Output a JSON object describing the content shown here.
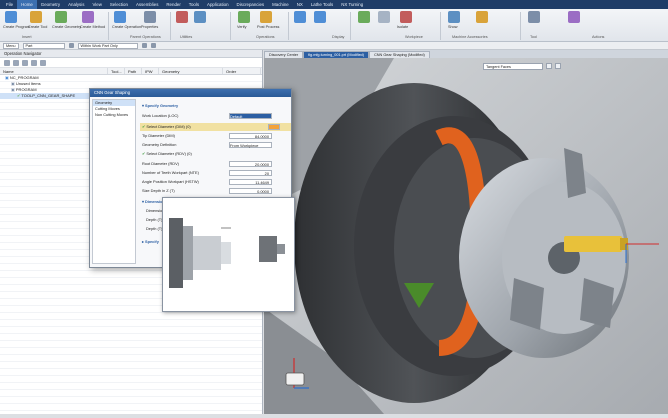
{
  "menu": [
    "File",
    "Home",
    "Geometry",
    "Analysis",
    "View",
    "Selection",
    "Assemblies",
    "Render",
    "Tools",
    "Application",
    "Discrepancies",
    "Machine",
    "NX",
    "Lathe Tools",
    "NX Turning"
  ],
  "menu_active_index": 1,
  "ribbon": {
    "buttons": [
      "Create Program",
      "Create Tool",
      "Create Geometry",
      "Create Method",
      "Create Operation",
      "Properties",
      "Shop Documentation",
      "Mfg Objects",
      "Verify",
      "Post Process",
      "Generate Tool Path",
      "Display Tool Path",
      "Simulate",
      "Cut Stock",
      "Isolate",
      "Show",
      "Display Object",
      "Sync",
      "Scroll"
    ],
    "groups": [
      "Insert",
      "Parent Operations",
      "Utilities",
      "Operations",
      "Display",
      "Workpiece",
      "Machine Accessories",
      "Tool",
      "Actions"
    ]
  },
  "selection_bar": {
    "menu_label": "Menu",
    "filter_value": "Part",
    "scope_value": "Within Work Part Only"
  },
  "navigator": {
    "title": "Operation Navigator",
    "columns": [
      "Name",
      "Tool...",
      "Path",
      "IPW",
      "Geometry",
      "Order"
    ],
    "rows": [
      {
        "label": "NC_PROGRAM",
        "indent": 0
      },
      {
        "label": "Unused Items",
        "indent": 1
      },
      {
        "label": "PROGRAM",
        "indent": 1
      },
      {
        "label": "TOOLP_CNN_GEAR_SHAPE",
        "indent": 2
      }
    ]
  },
  "tabs": [
    "Discovery Center",
    "fig.mfg.turning_001.prt (Modified)",
    "CNN Gear Shaping (Modified)"
  ],
  "viewport": {
    "filter_value": "Tangent Faces"
  },
  "dialog": {
    "title": "CNN Gear Shaping",
    "left_items": [
      "Geometry",
      "Cutting Moves",
      "Non Cutting Moves"
    ],
    "section_geometry": "Specify Geometry",
    "work_location_label": "Work Location (LOC)",
    "work_location_value": "Default",
    "select_diameter_label": "Select Diameter (DIM) (0)",
    "tip_diameter_label": "Tip Diameter (DIM)",
    "tip_diameter_value": "84.0000",
    "geometry_definition_label": "Geometry Definition",
    "geometry_definition_value": "From Workpiece",
    "select_diameter2_label": "Select Diameter (RDV) (0)",
    "root_diameter_label": "Root Diameter (RDV)",
    "root_diameter_value": "20.0000",
    "teeth_label": "Number of Teeth Workpart (NTE)",
    "teeth_value": "20",
    "helix_label": "Angle Position Workpart (HSTW)",
    "helix_value": "11.4649",
    "size_depth_label": "Size Depth in Z (T)",
    "size_depth_value": "0.0000",
    "section_dimensions": "Dimensions",
    "dim_rows": [
      "Dimension",
      "Depth (T)",
      "Depth (T)"
    ],
    "section_cut": "Specify"
  }
}
